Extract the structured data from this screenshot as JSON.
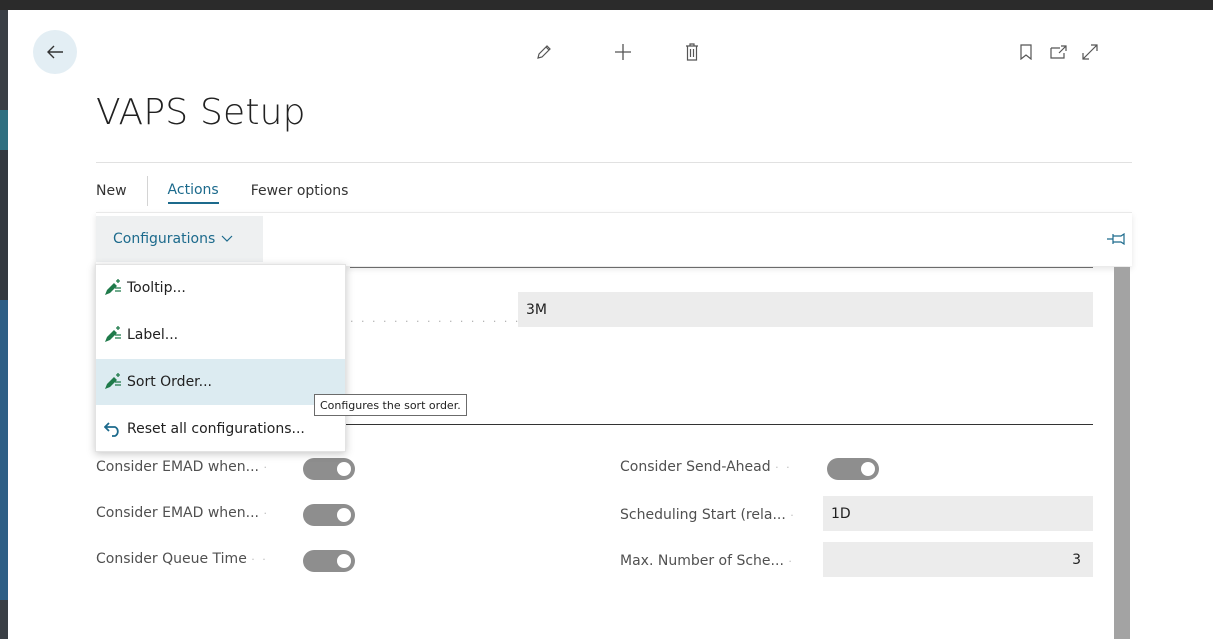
{
  "page": {
    "title": "VAPS Setup"
  },
  "toolbar": {
    "icons": [
      "back-arrow-icon",
      "edit-pencil-icon",
      "new-plus-icon",
      "delete-trash-icon",
      "bookmark-icon",
      "open-new-window-icon",
      "expand-icon"
    ]
  },
  "menu": {
    "new_label": "New",
    "actions_label": "Actions",
    "fewer_label": "Fewer options"
  },
  "actions": {
    "configurations_label": "Configurations"
  },
  "dropdown": {
    "items": [
      {
        "label": "Tooltip...",
        "icon": "personalize-icon"
      },
      {
        "label": "Label...",
        "icon": "personalize-icon"
      },
      {
        "label": "Sort Order...",
        "icon": "personalize-icon",
        "highlighted": true
      },
      {
        "label": "Reset all configurations...",
        "icon": "undo-arrow-icon"
      }
    ]
  },
  "tooltip": {
    "text": "Configures the sort order."
  },
  "fields": {
    "top_value": "3M",
    "left": [
      {
        "label": "Consider EMAD when...",
        "on": true
      },
      {
        "label": "Consider EMAD when...",
        "on": true
      },
      {
        "label": "Consider Queue Time",
        "on": true
      }
    ],
    "send_ahead": {
      "label": "Consider Send-Ahead",
      "on": true
    },
    "scheduling_start": {
      "label": "Scheduling Start (rela...",
      "value": "1D"
    },
    "max_number": {
      "label": "Max. Number of Sche...",
      "value": "3"
    }
  },
  "colors": {
    "accent": "#1c6a8c",
    "highlight": "#dcebf1",
    "toggle": "#8e8e8e",
    "field_bg": "#ececec"
  }
}
